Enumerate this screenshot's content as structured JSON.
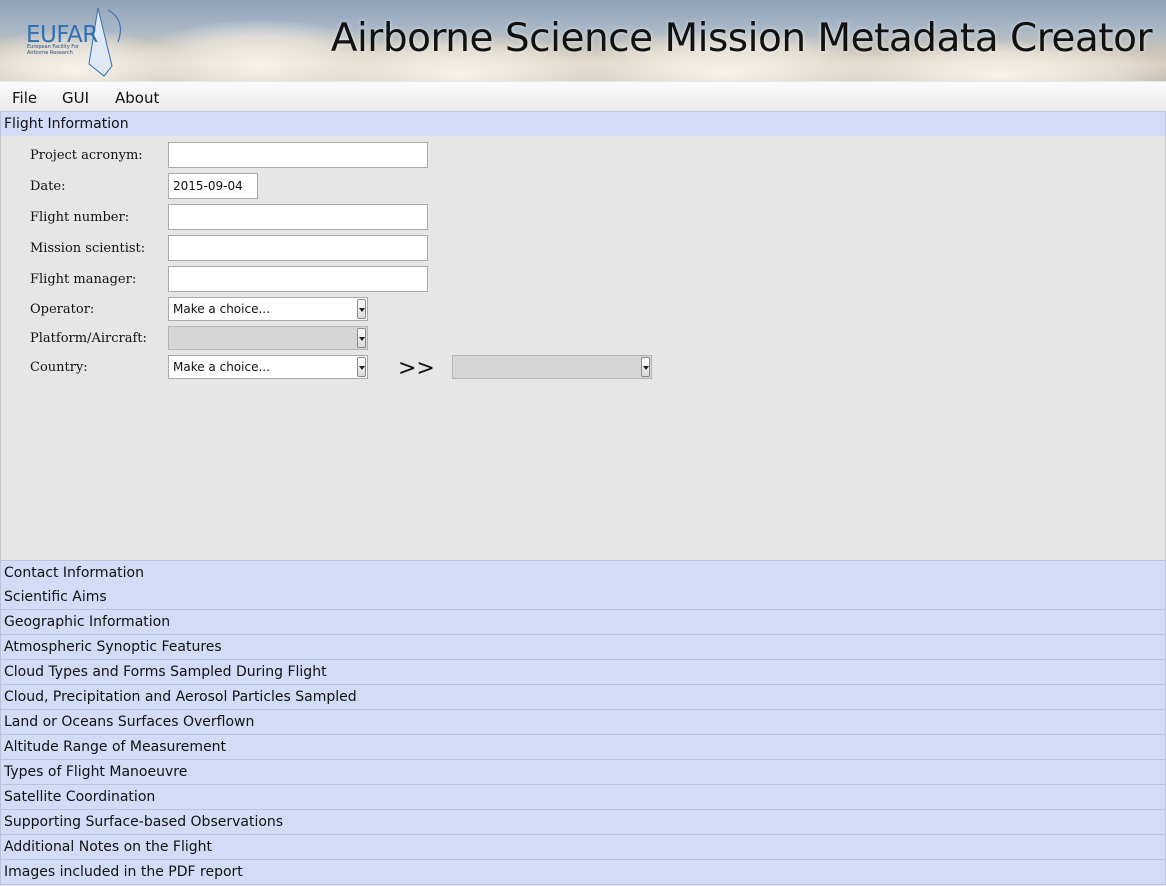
{
  "banner": {
    "logo_text": "EUFAR",
    "logo_subtext": "European Facility For Airborne Research",
    "title": "Airborne Science Mission Metadata Creator"
  },
  "menu": {
    "file": "File",
    "gui": "GUI",
    "about": "About"
  },
  "flight_info": {
    "header": "Flight Information",
    "project_acronym": {
      "label": "Project acronym:",
      "value": ""
    },
    "date": {
      "label": "Date:",
      "value": "2015-09-04"
    },
    "flight_number": {
      "label": "Flight number:",
      "value": ""
    },
    "mission_scientist": {
      "label": "Mission scientist:",
      "value": ""
    },
    "flight_manager": {
      "label": "Flight manager:",
      "value": ""
    },
    "operator": {
      "label": "Operator:",
      "value": "Make a choice..."
    },
    "platform": {
      "label": "Platform/Aircraft:",
      "value": ""
    },
    "country": {
      "label": "Country:",
      "value": "Make a choice..."
    },
    "country_arrows": ">>",
    "country_secondary": ""
  },
  "sections": [
    "Contact Information",
    "Scientific Aims",
    "Geographic Information",
    "Atmospheric Synoptic Features",
    "Cloud Types and Forms Sampled During Flight",
    "Cloud, Precipitation and Aerosol Particles Sampled",
    "Land or Oceans Surfaces Overflown",
    "Altitude Range of Measurement",
    "Types of Flight Manoeuvre",
    "Satellite Coordination",
    "Supporting Surface-based Observations",
    "Additional Notes on the Flight",
    "Images included in the PDF report"
  ]
}
